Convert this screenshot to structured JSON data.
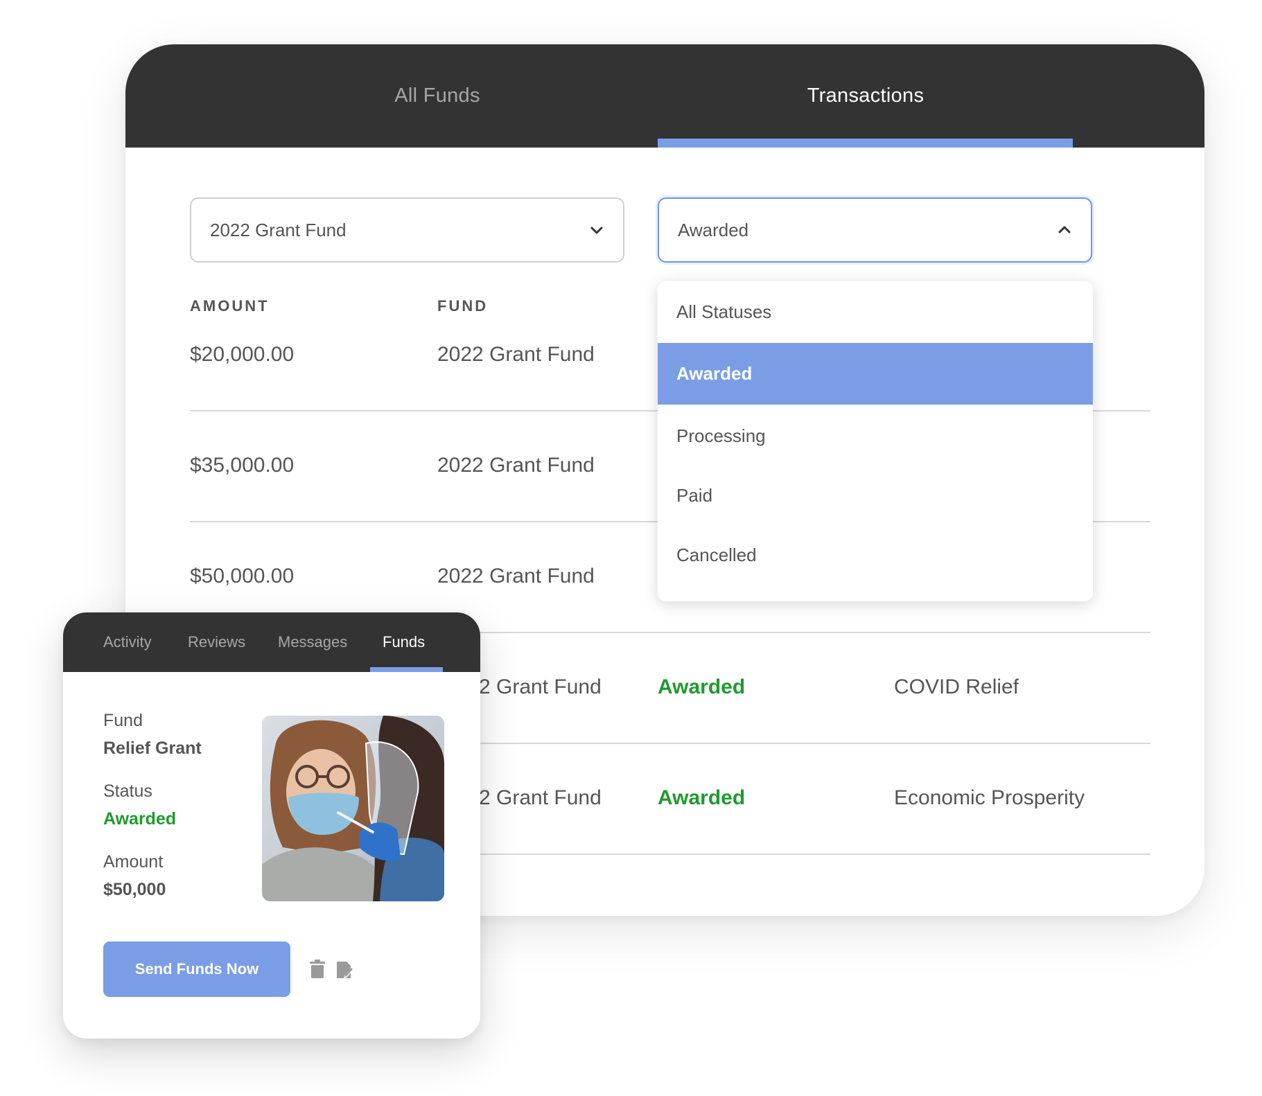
{
  "main": {
    "tabs": [
      {
        "label": "All Funds",
        "active": false
      },
      {
        "label": "Transactions",
        "active": true
      }
    ],
    "fund_select": {
      "value": "2022 Grant Fund",
      "icon": "chevron-down-icon"
    },
    "status_select": {
      "value": "Awarded",
      "icon": "chevron-up-icon"
    },
    "columns": [
      "AMOUNT",
      "FUND"
    ],
    "rows": [
      {
        "amount": "$20,000.00",
        "fund": "2022 Grant Fund"
      },
      {
        "amount": "$35,000.00",
        "fund": "2022 Grant Fund"
      },
      {
        "amount": "$50,000.00",
        "fund": "2022 Grant Fund"
      },
      {
        "fund": "2 Grant Fund",
        "status": "Awarded",
        "category": "COVID Relief"
      },
      {
        "fund": "2 Grant Fund",
        "status": "Awarded",
        "category": "Economic Prosperity"
      }
    ],
    "dropdown": {
      "options": [
        {
          "label": "All Statuses",
          "selected": false
        },
        {
          "label": "Awarded",
          "selected": true
        },
        {
          "label": "Processing",
          "selected": false
        },
        {
          "label": "Paid",
          "selected": false
        },
        {
          "label": "Cancelled",
          "selected": false
        }
      ]
    }
  },
  "card": {
    "tabs": [
      {
        "label": "Activity",
        "active": false
      },
      {
        "label": "Reviews",
        "active": false
      },
      {
        "label": "Messages",
        "active": false
      },
      {
        "label": "Funds",
        "active": true
      }
    ],
    "fund_label": "Fund",
    "fund_value": "Relief Grant",
    "status_label": "Status",
    "status_value": "Awarded",
    "amount_label": "Amount",
    "amount_value": "$50,000",
    "send_button": "Send Funds Now",
    "icons": [
      "trash-icon",
      "edit-note-icon"
    ],
    "photo": "masked-woman-swab-test-photo"
  },
  "colors": {
    "header_dark": "#333333",
    "accent_blue": "#7a9de6",
    "status_green": "#1f9a2f",
    "text_gray": "#555555",
    "inactive_tab": "#a7a7a7"
  }
}
